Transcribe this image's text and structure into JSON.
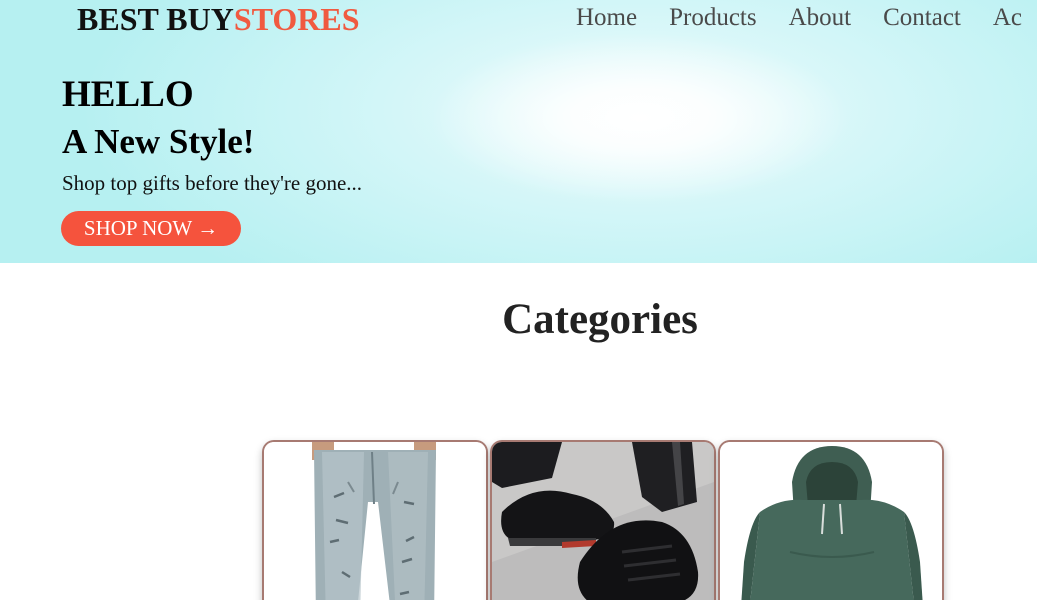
{
  "brand": {
    "name_main": "BEST BUY",
    "name_accent": "STORES",
    "accent_color": "#f05a40"
  },
  "nav": {
    "items": [
      "Home",
      "Products",
      "About",
      "Contact",
      "Ac"
    ]
  },
  "hero": {
    "greeting": "HELLO",
    "tagline": "A New Style!",
    "subline": "Shop top gifts before they're gone...",
    "cta_label": "SHOP NOW →",
    "cta_color": "#f5533d"
  },
  "categories": {
    "title": "Categories",
    "items": [
      {
        "icon": "jeans-image"
      },
      {
        "icon": "sneakers-image"
      },
      {
        "icon": "hoodie-image"
      }
    ]
  }
}
